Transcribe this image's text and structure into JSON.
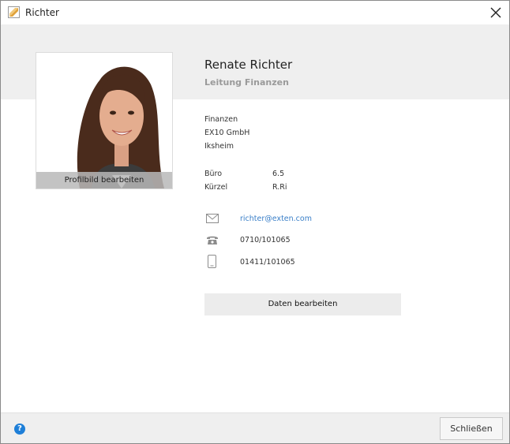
{
  "window": {
    "title": "Richter"
  },
  "profile": {
    "name": "Renate Richter",
    "role": "Leitung Finanzen",
    "edit_photo_label": "Profilbild bearbeiten"
  },
  "org": [
    "Finanzen",
    "EX10 GmbH",
    "Iksheim"
  ],
  "details": [
    {
      "label": "Büro",
      "value": "6.5"
    },
    {
      "label": "Kürzel",
      "value": "R.Ri"
    }
  ],
  "contacts": {
    "email": "richter@exten.com",
    "phone": "0710/101065",
    "mobile": "01411/101065"
  },
  "buttons": {
    "edit_data": "Daten bearbeiten",
    "close": "Schließen",
    "help": "?"
  },
  "colors": {
    "accent": "#3a7fc8",
    "help": "#1e7fd8",
    "band": "#efefef"
  },
  "icons": {
    "app": "app-window-icon",
    "close": "close-x-icon",
    "email": "envelope-icon",
    "phone": "telephone-icon",
    "mobile": "mobile-phone-icon",
    "help": "question-icon"
  }
}
